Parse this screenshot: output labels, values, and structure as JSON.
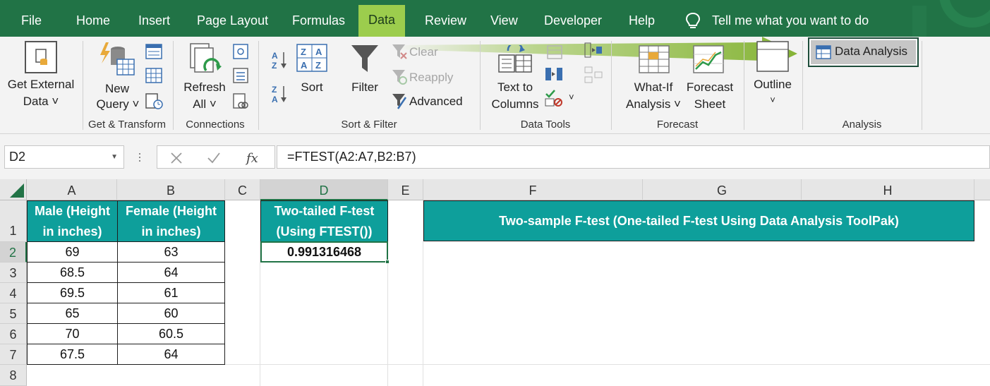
{
  "tabs": [
    "File",
    "Home",
    "Insert",
    "Page Layout",
    "Formulas",
    "Data",
    "Review",
    "View",
    "Developer",
    "Help"
  ],
  "active_tab": "Data",
  "tell_me": "Tell me what you want to do",
  "ribbon": {
    "get_external_data": [
      "Get External",
      "Data ˅"
    ],
    "new_query": [
      "New",
      "Query ˅"
    ],
    "refresh_all": [
      "Refresh",
      "All ˅"
    ],
    "sort": "Sort",
    "filter": "Filter",
    "clear": "Clear",
    "reapply": "Reapply",
    "advanced": "Advanced",
    "text_to_columns": [
      "Text to",
      "Columns"
    ],
    "what_if": [
      "What-If",
      "Analysis ˅"
    ],
    "forecast_sheet": [
      "Forecast",
      "Sheet"
    ],
    "outline": "Outline",
    "data_analysis": "Data Analysis",
    "groups": {
      "get_transform": "Get & Transform",
      "connections": "Connections",
      "sort_filter": "Sort & Filter",
      "data_tools": "Data Tools",
      "forecast": "Forecast",
      "analysis": "Analysis"
    }
  },
  "formula_bar": {
    "name_box": "D2",
    "formula": "=FTEST(A2:A7,B2:B7)"
  },
  "columns": [
    "A",
    "B",
    "C",
    "D",
    "E",
    "F",
    "G",
    "H"
  ],
  "rows": [
    "1",
    "2",
    "3",
    "4",
    "5",
    "6",
    "7",
    "8"
  ],
  "sheet": {
    "A1": [
      "Male (Height",
      "in inches)"
    ],
    "B1": [
      "Female (Height",
      "in inches)"
    ],
    "D1": [
      "Two-tailed F-test",
      "(Using FTEST())"
    ],
    "F1": "Two-sample F-test (One-tailed F-test Using Data Analysis ToolPak)",
    "D2": "0.991316468",
    "male": [
      "69",
      "68.5",
      "69.5",
      "65",
      "70",
      "67.5"
    ],
    "female": [
      "63",
      "64",
      "61",
      "60",
      "60.5",
      "64"
    ]
  },
  "colors": {
    "ribbon_tab_bar": "#217346",
    "active_tab": "#9ccd4d",
    "header_fill": "#0e9f9b",
    "arrow": "#8cbc3a"
  }
}
